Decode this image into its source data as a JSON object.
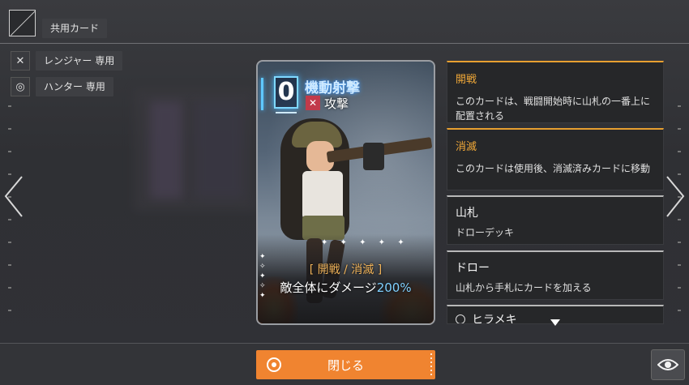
{
  "header": {
    "common_tag": "共用カード"
  },
  "roles": [
    {
      "icon": "crossed-swords-icon",
      "label": "レンジャー 専用"
    },
    {
      "icon": "target-icon",
      "label": "ハンター 専用"
    }
  ],
  "card": {
    "cost": "0",
    "name": "機動射撃",
    "type_icon": "crossed-swords-icon",
    "type": "攻撃",
    "keywords": "[ 開戦 / 消滅 ]",
    "effect_prefix": "敵全体にダメージ",
    "effect_value": "200%",
    "accent": "#7fd8ff"
  },
  "keywords": [
    {
      "title": "開戦",
      "desc": "このカードは、戦闘開始時に山札の一番上に配置される",
      "style": "orange"
    },
    {
      "title": "消滅",
      "desc": "このカードは使用後、消滅済みカードに移動",
      "style": "orange"
    },
    {
      "title": "山札",
      "desc": "ドローデッキ",
      "style": "white"
    },
    {
      "title": "ドロー",
      "desc": "山札から手札にカードを加える",
      "style": "white"
    },
    {
      "title": "ヒラメキ",
      "desc": "",
      "style": "white"
    }
  ],
  "footer": {
    "close_label": "閉じる"
  },
  "colors": {
    "button": "#f08430",
    "keyword_accent": "#f0a838",
    "background": "#2f3034"
  }
}
